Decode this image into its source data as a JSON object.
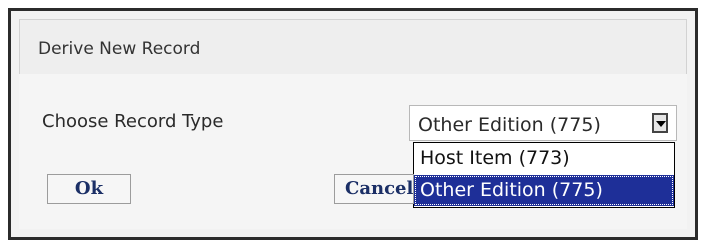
{
  "dialog": {
    "title": "Derive New Record",
    "field_label": "Choose Record Type",
    "select": {
      "selected": "Other Edition (775)",
      "options": [
        "Host Item (773)",
        "Other Edition (775)"
      ]
    },
    "buttons": {
      "ok": "Ok",
      "cancel": "Cancel"
    }
  }
}
